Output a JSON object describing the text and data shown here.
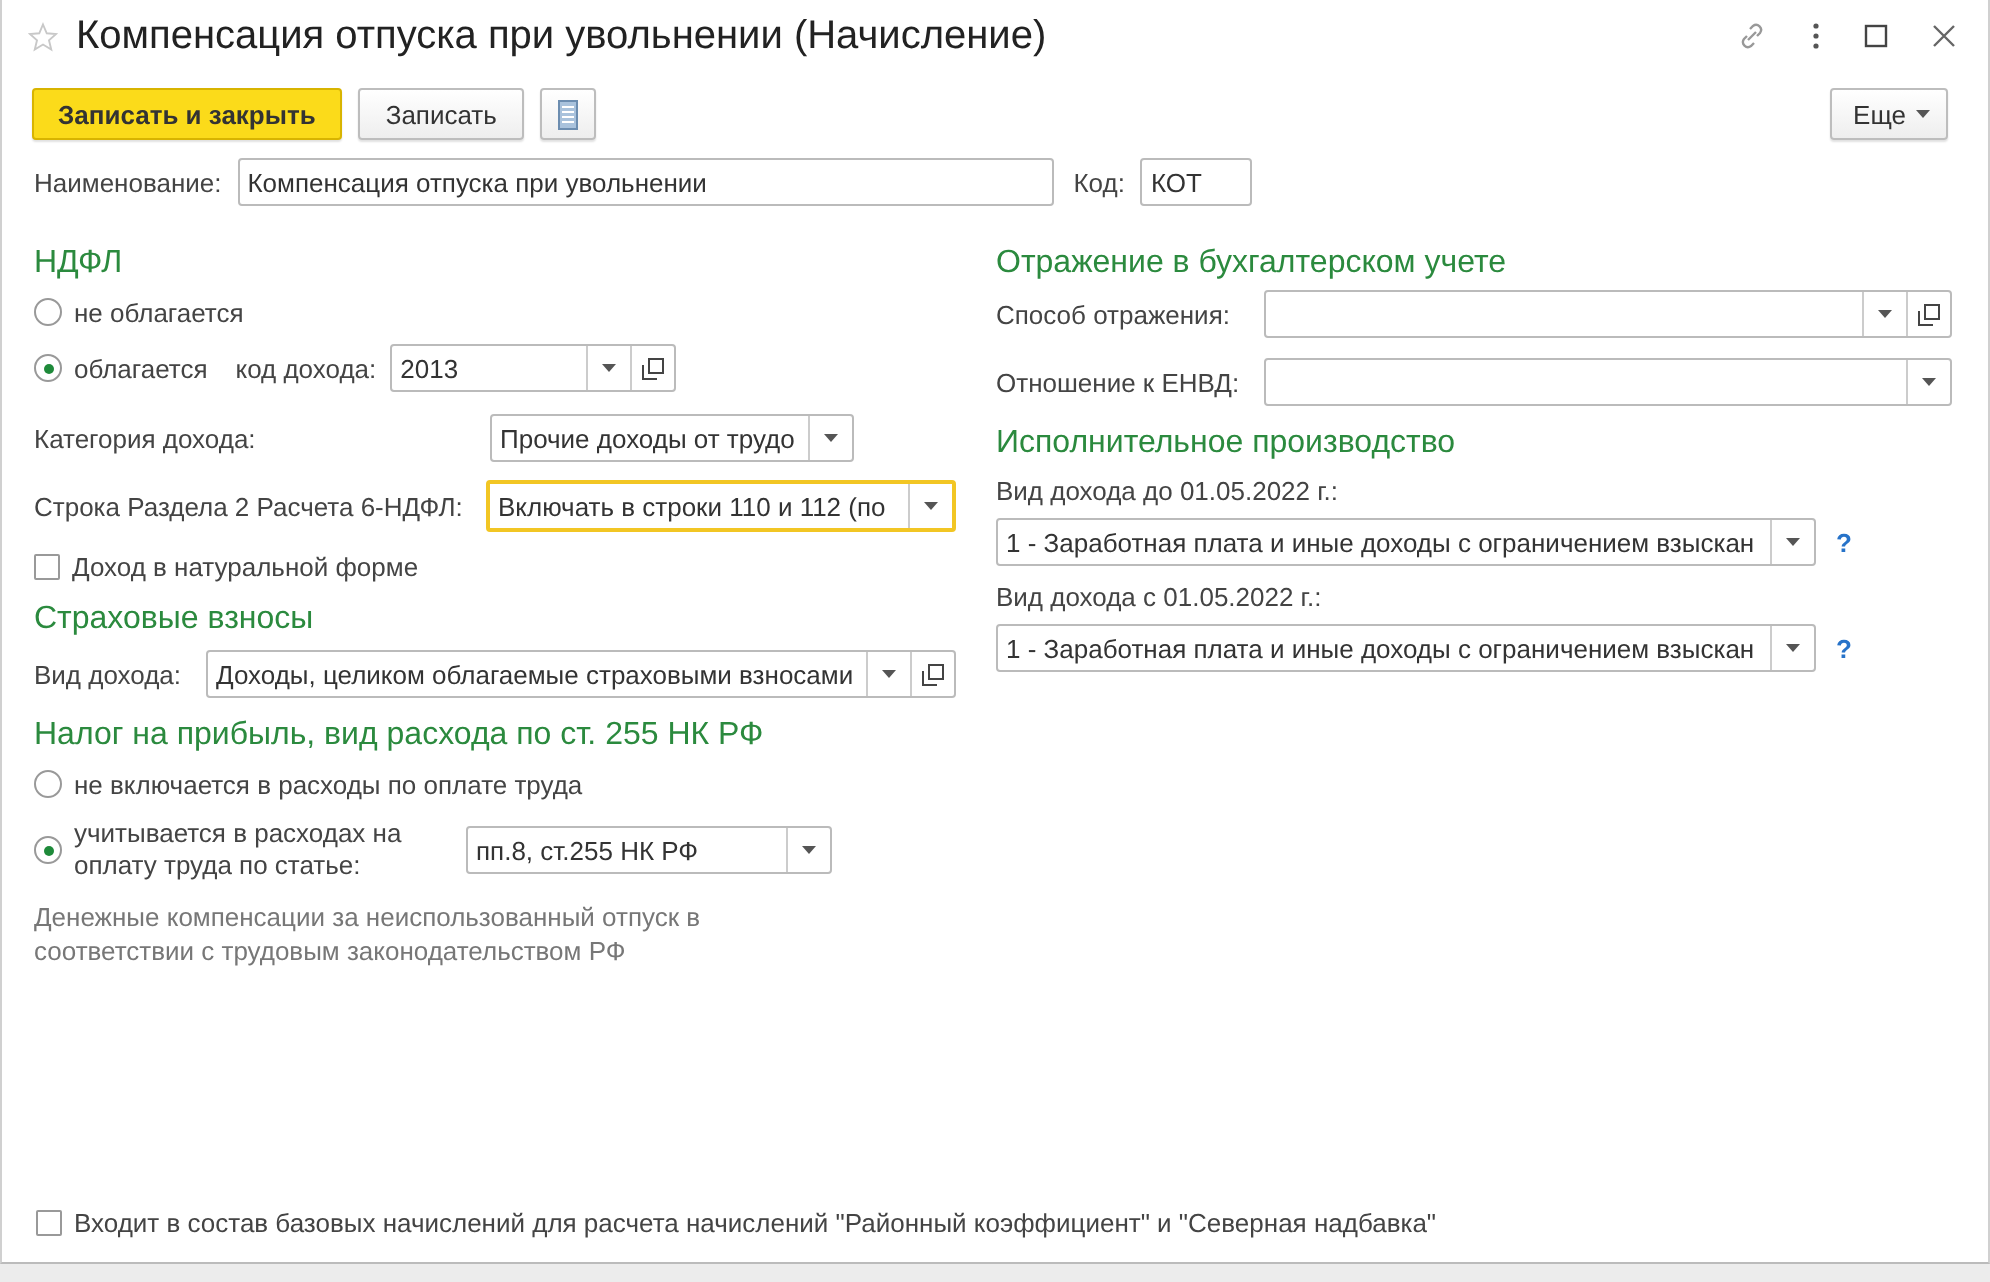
{
  "window": {
    "title": "Компенсация отпуска при увольнении (Начисление)"
  },
  "toolbar": {
    "buttons": [
      {
        "kind": "primary",
        "label": "Записать и закрыть"
      },
      {
        "kind": "default",
        "label": "Записать"
      },
      {
        "kind": "icon"
      }
    ],
    "more": "Еще"
  },
  "name_field": {
    "label": "Наименование:",
    "value": "Компенсация отпуска при увольнении"
  },
  "code_field": {
    "label": "Код:",
    "value": "КОТ"
  },
  "ndfl": {
    "title": "НДФЛ",
    "options": [
      {
        "label": "не облагается",
        "selected": false
      },
      {
        "label": "облагается",
        "selected": true
      }
    ],
    "income_code": {
      "label": "код дохода:",
      "value": "2013",
      "open_button": true
    },
    "category": {
      "label": "Категория дохода:",
      "value": "Прочие доходы от трудо",
      "open_button": false
    },
    "row_6ndfl": {
      "label": "Строка Раздела 2 Расчета 6-НДФЛ:",
      "value": "Включать в строки 110 и 112 (по",
      "open_button": false,
      "focused": true
    },
    "in_kind": {
      "label": "Доход в натуральной форме",
      "checked": false
    }
  },
  "insurance": {
    "title": "Страховые взносы",
    "income_type": {
      "label": "Вид дохода:",
      "value": "Доходы, целиком облагаемые страховыми взносами",
      "open_button": true
    }
  },
  "profit_tax": {
    "title": "Налог на прибыль, вид расхода по ст. 255 НК РФ",
    "options": [
      {
        "label": "не включается в расходы по оплате труда",
        "selected": false
      },
      {
        "label": "учитывается в расходах на оплату труда по статье:",
        "selected": true
      }
    ],
    "article": {
      "value": "пп.8, ст.255 НК РФ",
      "open_button": false
    },
    "note": "Денежные компенсации за неиспользованный отпуск в соответствии с трудовым законодательством РФ"
  },
  "accounting": {
    "title": "Отражение в бухгалтерском учете",
    "fields": [
      {
        "label": "Способ отражения:",
        "open_button": true
      },
      {
        "label": "Отношение к ЕНВД:",
        "open_button": false
      }
    ]
  },
  "enforcement": {
    "title": "Исполнительное производство",
    "fields": [
      {
        "label": "Вид дохода до 01.05.2022 г.:",
        "value": "1 - Заработная плата и иные доходы с ограничением взыскан",
        "help": "?"
      },
      {
        "label": "Вид дохода с 01.05.2022 г.:",
        "value": "1 - Заработная плата и иные доходы с ограничением взыскан",
        "help": "?"
      }
    ]
  },
  "base_accruals": {
    "label": "Входит в состав базовых начислений для расчета начислений \"Районный коэффициент\" и \"Северная надбавка\"",
    "checked": false
  }
}
